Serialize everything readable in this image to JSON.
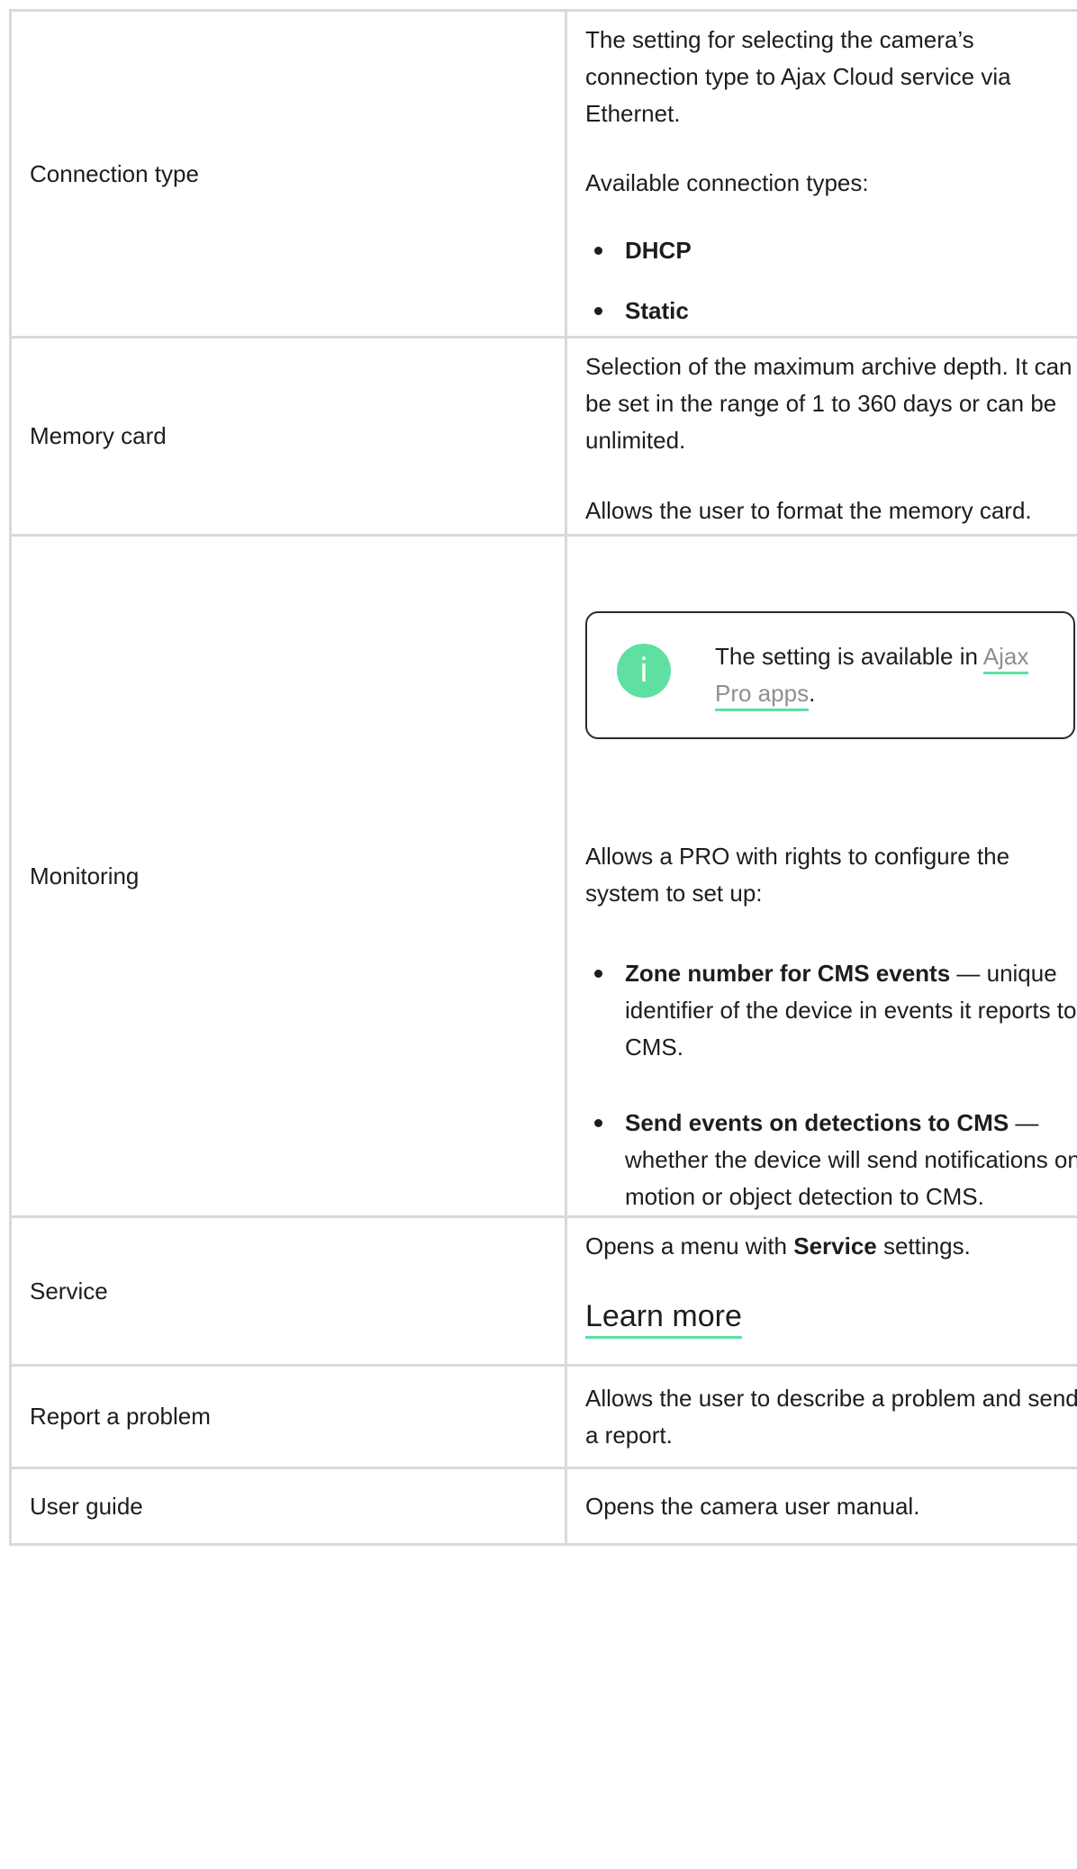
{
  "rows": [
    {
      "name": "Connection type",
      "desc_p1": "The setting for selecting the camera’s connection type to Ajax Cloud service via Ethernet.",
      "desc_p2": "Available connection types:",
      "bullets": [
        "DHCP",
        "Static"
      ]
    },
    {
      "name": "Memory card",
      "desc_p1": "Selection of the maximum archive depth. It can be set in the range of 1 to 360 days or can be unlimited.",
      "desc_p2": "Allows the user to format the memory card."
    },
    {
      "name": "Monitoring",
      "notice_icon": "i",
      "notice_text": "The setting is available in ",
      "notice_link": "Ajax Pro apps",
      "notice_after": ".",
      "desc_p1": "Allows a PRO with rights to configure the system to set up:",
      "bullets": [
        {
          "bold": "Zone number for CMS events",
          "rest": " — unique identifier of the device in events it reports to CMS."
        },
        {
          "bold": "Send events on detections to CMS",
          "rest": " — whether the device will send notifications on motion or object detection to CMS."
        }
      ]
    },
    {
      "name": "Service",
      "desc_before": "Opens a menu with ",
      "desc_bold": "Service",
      "desc_after": " settings.",
      "link": "Learn more"
    },
    {
      "name": "Report a problem",
      "desc": "Allows the user to describe a problem and send a report."
    },
    {
      "name": "User guide",
      "desc": "Opens the camera user manual."
    }
  ],
  "colors": {
    "accent": "#5fe0a2",
    "border": "#d9d9d9",
    "text": "#1d1d1f",
    "link_text": "#8f8f8f"
  },
  "icons": {
    "notice": "info-icon",
    "bullet": "bullet-dot"
  }
}
